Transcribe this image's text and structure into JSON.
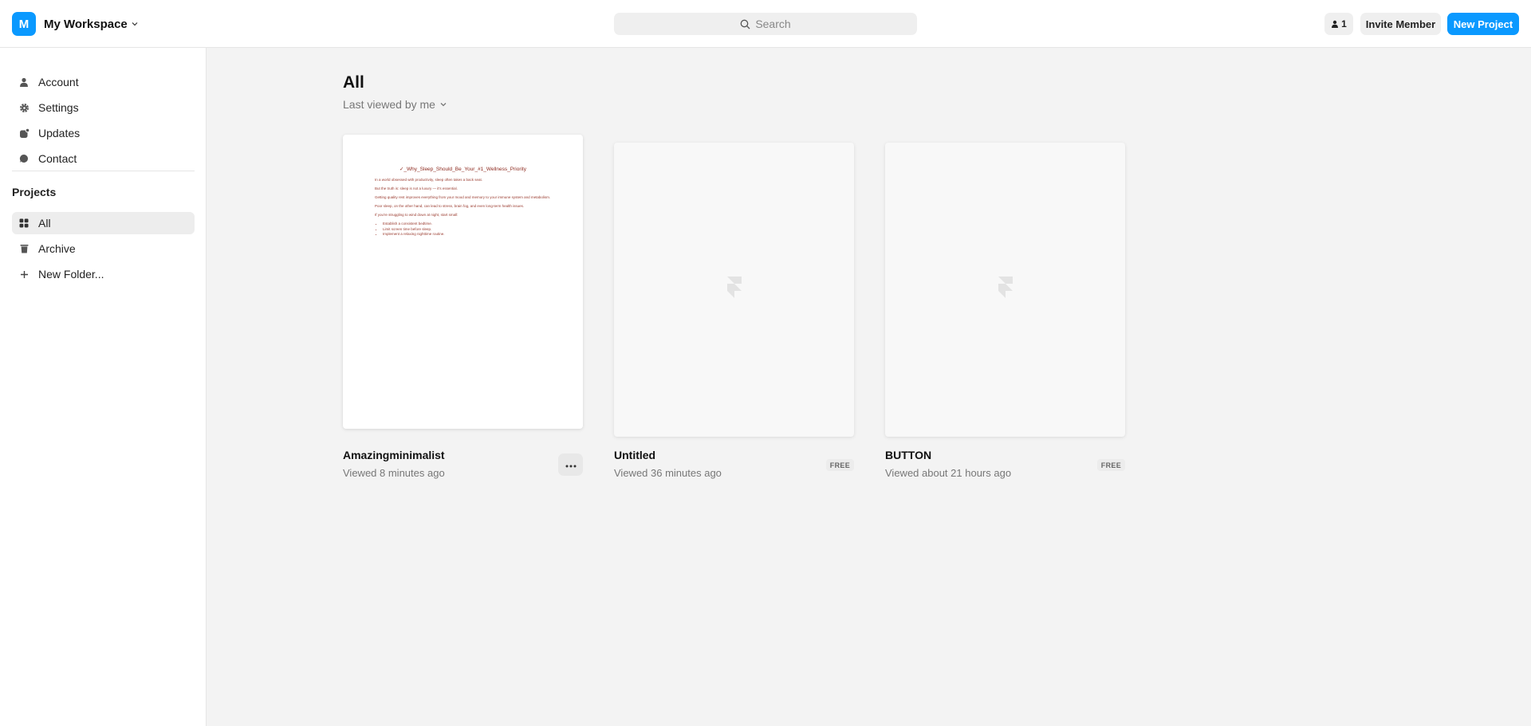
{
  "workspace": {
    "initial": "M",
    "name": "My Workspace"
  },
  "search": {
    "placeholder": "Search"
  },
  "header": {
    "member_count": "1",
    "invite_label": "Invite Member",
    "new_project_label": "New Project"
  },
  "sidebar": {
    "items": [
      {
        "label": "Account",
        "icon": "user-icon"
      },
      {
        "label": "Settings",
        "icon": "gear-icon"
      },
      {
        "label": "Updates",
        "icon": "updates-icon"
      },
      {
        "label": "Contact",
        "icon": "chat-icon"
      }
    ],
    "projects_title": "Projects",
    "project_items": [
      {
        "label": "All",
        "icon": "grid-icon",
        "active": true
      },
      {
        "label": "Archive",
        "icon": "trash-icon",
        "active": false
      },
      {
        "label": "New Folder...",
        "icon": "plus-icon",
        "active": false
      }
    ]
  },
  "main": {
    "title": "All",
    "sort_label": "Last viewed by me",
    "projects": [
      {
        "title": "Amazingminimalist",
        "subtitle": "Viewed 8 minutes ago",
        "preview": {
          "heading": "✓_Why_Sleep_Should_Be_Your_#1_Wellness_Priority",
          "paragraphs": [
            "In a world obsessed with productivity, sleep often takes a back seat.",
            "But the truth is: sleep is not a luxury — it's essential.",
            "Getting quality rest improves everything from your mood and memory to your immune system and metabolism.",
            "Poor sleep, on the other hand, can lead to stress, brain fog, and even long-term health issues.",
            "If you're struggling to wind down at night, start small:"
          ],
          "bullets": [
            "Establish a consistent bedtime.",
            "Limit screen time before sleep.",
            "Implement a relaxing nighttime routine."
          ]
        }
      },
      {
        "title": "Untitled",
        "subtitle": "Viewed 36 minutes ago",
        "badge": "FREE"
      },
      {
        "title": "BUTTON",
        "subtitle": "Viewed about 21 hours ago",
        "badge": "FREE"
      }
    ]
  },
  "colors": {
    "accent": "#0a99ff",
    "background": "#f3f3f3",
    "sidebar": "#ffffff"
  }
}
